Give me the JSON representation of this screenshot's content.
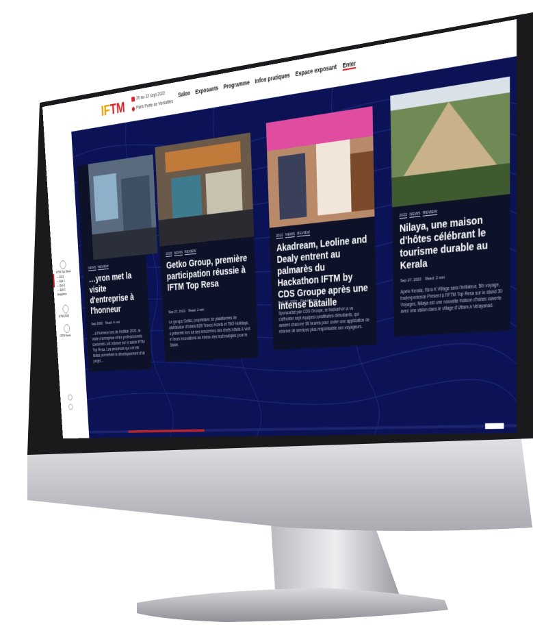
{
  "header": {
    "logo_part1": "IF",
    "logo_part2": "TM",
    "date": "20 au 22 sept 2022",
    "place": "Paris Porte de Versailles",
    "nav": [
      "Salon",
      "Exposants",
      "Programme",
      "Infos pratiques",
      "Espace exposant",
      "Enter"
    ]
  },
  "sidebar": {
    "items": [
      "IFTM Top Resa",
      "— 2022",
      "— Edit 1",
      "— Edit 2",
      "— Edit 3",
      "Magazine"
    ],
    "icon_labels": [
      "IFTM 2023",
      "IFTM News"
    ]
  },
  "cards": [
    {
      "tags": [
        "NEWS",
        "REVIEW"
      ],
      "title": "…yron met la visite d'entreprise à l'honneur",
      "date": "Sep 2022",
      "read": "Read: 4 min",
      "excerpt": "…à l'honneur lors de l'édition 2022, la visite d'entreprise et les professionnels concernés ont réservé sur le salon IFTM Top Resa. Les annonces qui ont été faites permettent le développement d'un projet…"
    },
    {
      "tags": [
        "2022",
        "NEWS",
        "REVIEW"
      ],
      "title": "Getko Group, première participation réussie à IFTM Top Resa",
      "date": "Sep 27, 2022",
      "read": "Read: 2 min",
      "excerpt": "Le groupe Getko, propriétaire de plateformes de distribution d'hôtels B2B Travco Hotels et TBO Holidays, a présenté lors de ses rencontres des chefs hôtels & vols et leurs innovations au niveau des technologies pour le Salon."
    },
    {
      "tags": [
        "2022",
        "NEWS",
        "REVIEW"
      ],
      "title": "Akadream, Leoline and Dealy entrent au palmarès du Hackathon IFTM by CDS Groupe après une intense bataille",
      "date": "Sep 27, 2022",
      "read": "Read: 3 min",
      "excerpt": "Sponsorisé par CDS Groupe, le hackathon a vu s'affronter sept équipes constituées d'étudiants, qui avaient chacune 36 heures pour coder une application de réserve de services plus responsable aux voyageurs."
    },
    {
      "tags": [
        "2022",
        "NEWS",
        "REVIEW"
      ],
      "title": "Nilaya, une maison d'hôtes célébrant le tourisme durable au Kerala",
      "date": "Sep 27, 2022",
      "read": "Read: 2 min",
      "excerpt": "Apelo Kerala, l'Isra K Village sera l'initiateur, 5th voyage, tradexperience Présent à l'IFTM Top Resa sur le stand 30 Voyages, Nilaya est une nouvelle maison d'hôtes ouverte avec une vision dans le village d'Uttara à Velayanad."
    }
  ],
  "colors": {
    "screen_bg": "#0b1356",
    "card_bg": "#0d1228",
    "accent": "#d6232a",
    "progress": "#b3262b"
  },
  "scroll_progress": 0.2
}
